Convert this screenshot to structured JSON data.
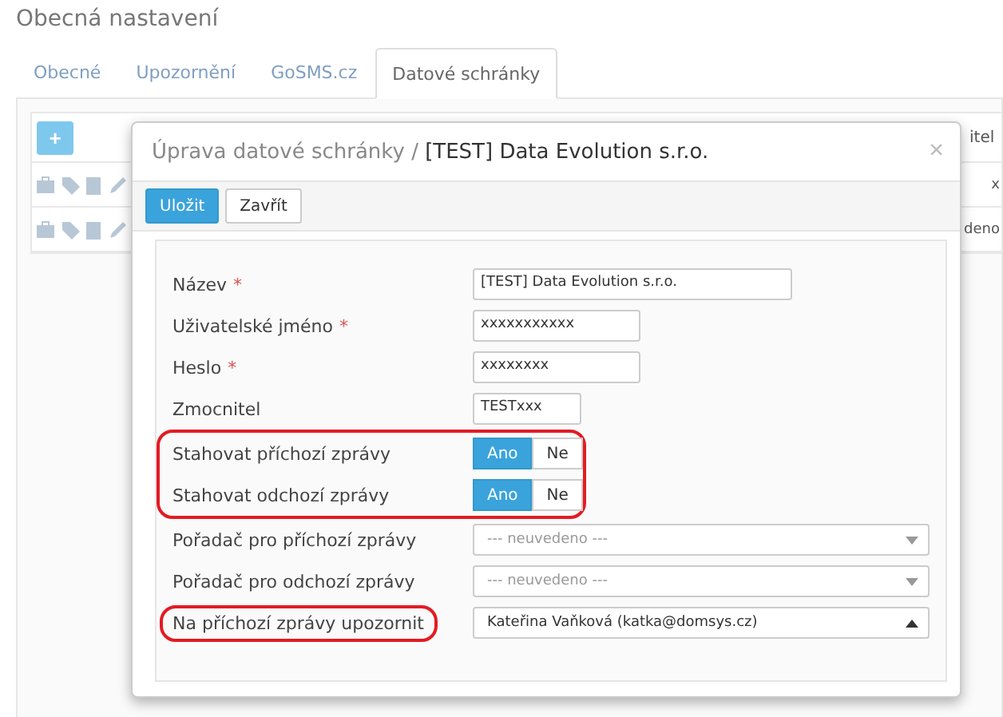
{
  "page_title": "Obecná nastavení",
  "tabs": [
    {
      "label": "Obecné",
      "selected": false
    },
    {
      "label": "Upozornění",
      "selected": false
    },
    {
      "label": "GoSMS.cz",
      "selected": false
    },
    {
      "label": "Datové schránky",
      "selected": true
    }
  ],
  "table": {
    "add_button": "+",
    "column_header": "itel",
    "rows": [
      {
        "cell": "x"
      },
      {
        "cell": "deno"
      }
    ]
  },
  "modal": {
    "title_prefix": "Úprava datové schránky / ",
    "title": "[TEST] Data Evolution s.r.o.",
    "close": "×",
    "buttons": [
      {
        "label": "Uložit",
        "kind": "primary"
      },
      {
        "label": "Zavřít",
        "kind": "default"
      }
    ],
    "fields": [
      {
        "kind": "text",
        "label": "Název",
        "required_mark": "*",
        "value": "[TEST] Data Evolution s.r.o."
      },
      {
        "kind": "text",
        "label": "Uživatelské jméno",
        "required_mark": "*",
        "value": "xxxxxxxxxxx"
      },
      {
        "kind": "text",
        "label": "Heslo",
        "required_mark": "*",
        "value": "xxxxxxxx"
      },
      {
        "kind": "text",
        "label": "Zmocnitel",
        "value": "TESTxxx"
      },
      {
        "kind": "toggle",
        "label": "Stahovat příchozí zprávy",
        "row_circled": true,
        "options": [
          {
            "label": "Ano",
            "selected": true
          },
          {
            "label": "Ne",
            "selected": false
          }
        ]
      },
      {
        "kind": "toggle",
        "label": "Stahovat odchozí zprávy",
        "row_circled": true,
        "options": [
          {
            "label": "Ano",
            "selected": true
          },
          {
            "label": "Ne",
            "selected": false
          }
        ]
      },
      {
        "kind": "select",
        "label": "Pořadač pro příchozí zprávy",
        "placeholder": "--- neuvedeno ---",
        "expanded": false
      },
      {
        "kind": "select",
        "label": "Pořadač pro odchozí zprávy",
        "placeholder": "--- neuvedeno ---",
        "expanded": false
      },
      {
        "kind": "select",
        "label": "Na příchozí zprávy upozornit",
        "label_circled": true,
        "value": "Kateřina Vaňková (katka@domsys.cz)",
        "expanded": true
      }
    ]
  }
}
